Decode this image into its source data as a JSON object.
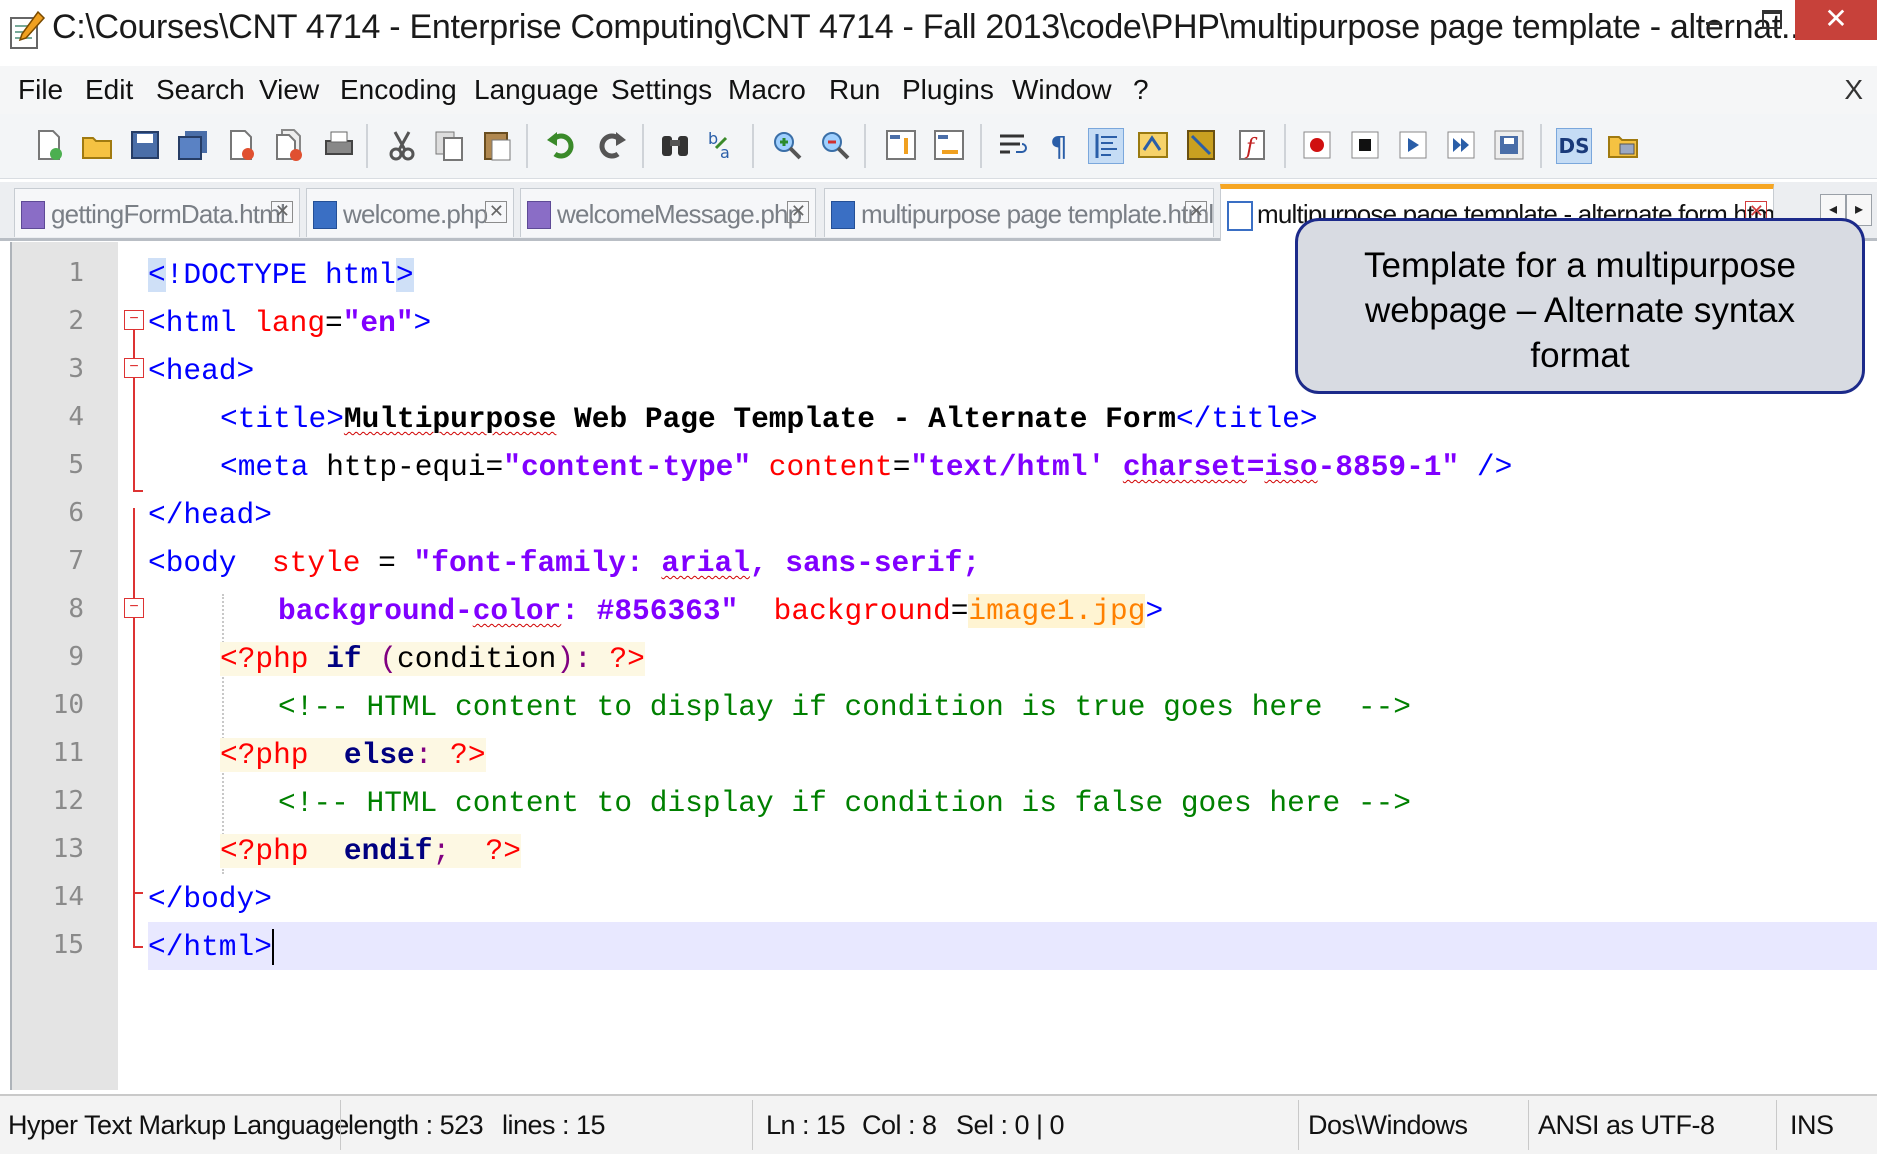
{
  "window": {
    "title": "C:\\Courses\\CNT 4714 - Enterprise Computing\\CNT 4714 - Fall 2013\\code\\PHP\\multipurpose page template - alternat...",
    "close_glyph": "✕"
  },
  "menu": {
    "items": [
      "File",
      "Edit",
      "Search",
      "View",
      "Encoding",
      "Language",
      "Settings",
      "Macro",
      "Run",
      "Plugins",
      "Window",
      "?"
    ],
    "close_label": "X"
  },
  "toolbar": {
    "icons": [
      "new-file-icon",
      "open-file-icon",
      "save-icon",
      "save-all-icon",
      "close-icon",
      "close-all-icon",
      "print-icon",
      "cut-icon",
      "copy-icon",
      "paste-icon",
      "undo-icon",
      "redo-icon",
      "find-icon",
      "replace-icon",
      "zoom-in-icon",
      "zoom-out-icon",
      "sync-vertical-icon",
      "sync-horizontal-icon",
      "word-wrap-icon",
      "show-all-chars-icon",
      "indent-guide-icon",
      "user-lang-icon",
      "doc-map-icon",
      "function-list-icon",
      "record-macro-icon",
      "stop-macro-icon",
      "play-macro-icon",
      "run-macro-multiple-icon",
      "save-macro-icon",
      "ds-icon",
      "folder-icon"
    ],
    "ds_label": "DS"
  },
  "tabs": [
    {
      "label": "gettingFormData.html",
      "active": false
    },
    {
      "label": "welcome.php",
      "active": false
    },
    {
      "label": "welcomeMessage.php",
      "active": false
    },
    {
      "label": "multipurpose page template.html",
      "active": false
    },
    {
      "label": "multipurpose page template - alternate form.html",
      "active": true
    }
  ],
  "tab_close_glyph": "✕",
  "tab_nav": {
    "left": "◂",
    "right": "▸"
  },
  "editor": {
    "line_numbers": [
      "1",
      "2",
      "3",
      "4",
      "5",
      "6",
      "7",
      "8",
      "9",
      "10",
      "11",
      "12",
      "13",
      "14",
      "15"
    ],
    "fold_glyph": "−",
    "line1": {
      "a": "<",
      "b": "!DOCTYPE html",
      "c": ">"
    },
    "line2": {
      "a": "<html ",
      "b": "lang",
      "c": "=",
      "d": "\"en\"",
      "e": ">"
    },
    "line3": {
      "a": "<head>"
    },
    "line4": {
      "a": "<title>",
      "b": "Multipurpose",
      "c": " Web Page Template - Alternate Form",
      "d": "</title>"
    },
    "line5": {
      "a": "<meta ",
      "b": "http-equi",
      "c": "=",
      "d": "\"content-type\"",
      "e": " content",
      "f": "=",
      "g": "\"text/html'",
      "h": " ",
      "i": "charset",
      "j": "=",
      "k": "iso",
      "l": "-8859-1\"",
      "m": " />"
    },
    "line6": {
      "a": "</head>"
    },
    "line7": {
      "a": "<body",
      "b": "  style",
      "c": " = ",
      "d": "\"font-family: ",
      "e": "arial",
      "f": ", sans-serif;"
    },
    "line8": {
      "a": "background-",
      "b": "color",
      "c": ": #856363\"",
      "d": "  background",
      "e": "=",
      "f": "image1.jpg",
      "g": ">"
    },
    "line9": {
      "a": "<?php",
      "b": " if",
      "c": " (",
      "d": "condition",
      "e": "):",
      "f": " ?>"
    },
    "line10": {
      "a": "<!-- HTML content to display if condition is true goes here  -->"
    },
    "line11": {
      "a": "<?php",
      "b": "  else",
      "c": ":",
      "d": " ?>"
    },
    "line12": {
      "a": "<!-- HTML content to display if condition is false goes here -->"
    },
    "line13": {
      "a": "<?php",
      "b": "  endif",
      "c": ";",
      "d": "  ?>"
    },
    "line14": {
      "a": "</body>"
    },
    "line15": {
      "a": "</html>"
    }
  },
  "callout": {
    "line1": "Template for a multipurpose",
    "line2": "webpage – Alternate syntax",
    "line3": "format"
  },
  "status": {
    "language": "Hyper Text Markup Language",
    "length": "length : 523",
    "lines": "lines : 15",
    "ln": "Ln : 15",
    "col": "Col : 8",
    "sel": "Sel : 0 | 0",
    "eol": "Dos\\Windows",
    "encoding": "ANSI as UTF-8",
    "mode": "INS"
  }
}
